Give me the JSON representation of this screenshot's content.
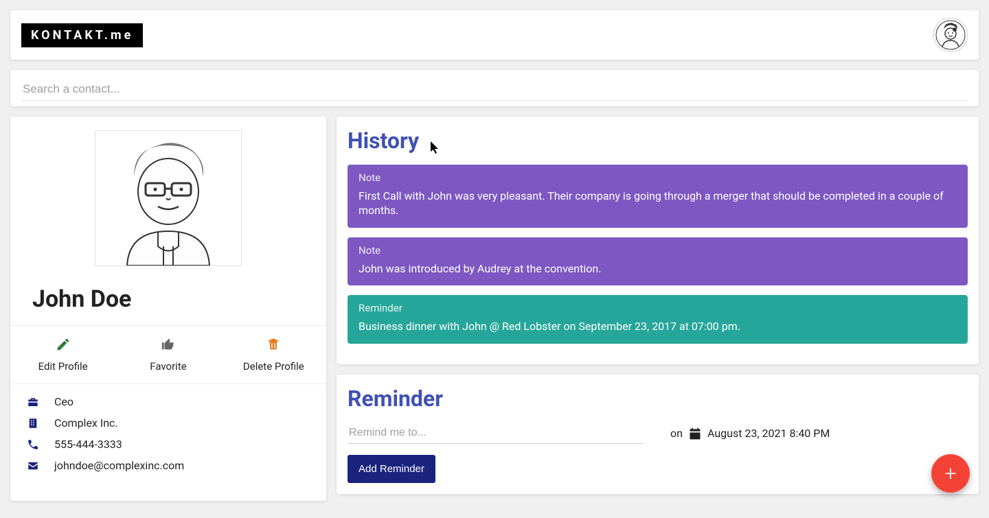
{
  "header": {
    "brand": "KONTAKT.me"
  },
  "search": {
    "placeholder": "Search a contact...",
    "value": ""
  },
  "profile": {
    "name": "John Doe",
    "actions": {
      "edit": "Edit Profile",
      "favorite": "Favorite",
      "delete": "Delete Profile"
    },
    "info": {
      "title": "Ceo",
      "company": "Complex Inc.",
      "phone": "555-444-3333",
      "email": "johndoe@complexinc.com"
    }
  },
  "panels": {
    "history_title": "History",
    "reminder_title": "Reminder"
  },
  "history": [
    {
      "kind": "Note",
      "body": "First Call with John was very pleasant. Their company is going through a merger that should be completed in a couple of months."
    },
    {
      "kind": "Note",
      "body": "John was introduced by Audrey at the convention."
    },
    {
      "kind": "Reminder",
      "body": "Business dinner with John @ Red Lobster on September 23, 2017 at 07:00 pm."
    }
  ],
  "reminder_form": {
    "placeholder": "Remind me to...",
    "on_label": "on",
    "date": "August 23, 2021 8:40 PM",
    "submit": "Add Reminder"
  },
  "fab": {
    "label": "+"
  },
  "colors": {
    "note_bg": "#7e57c2",
    "reminder_bg": "#26a69a",
    "primary": "#3f51b5",
    "primary_dark": "#1a237e",
    "fab": "#f44336"
  }
}
